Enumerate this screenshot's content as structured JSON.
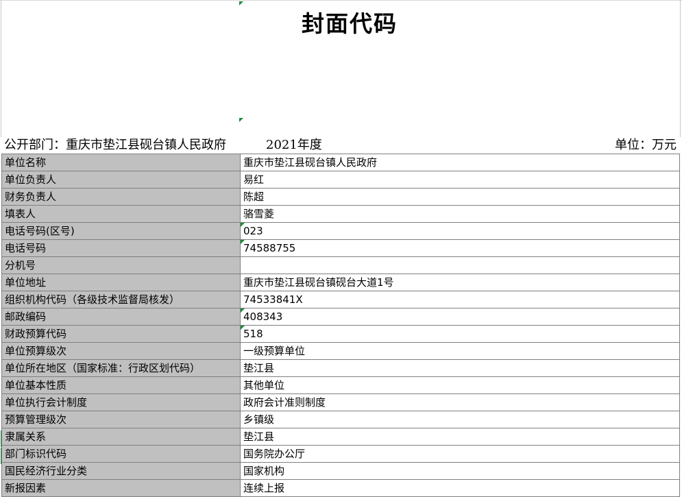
{
  "title": "封面代码",
  "header": {
    "department": "公开部门：重庆市垫江县砚台镇人民政府",
    "year": "2021年度",
    "unit": "单位：万元"
  },
  "rows": [
    {
      "label": "单位名称",
      "value": "重庆市垫江县砚台镇人民政府",
      "flag": false
    },
    {
      "label": "单位负责人",
      "value": "易红",
      "flag": false
    },
    {
      "label": "财务负责人",
      "value": "陈超",
      "flag": false
    },
    {
      "label": "填表人",
      "value": "骆雪菱",
      "flag": false
    },
    {
      "label": "电话号码(区号)",
      "value": "023",
      "flag": true
    },
    {
      "label": "电话号码",
      "value": "74588755",
      "flag": true
    },
    {
      "label": "分机号",
      "value": "",
      "flag": false
    },
    {
      "label": "单位地址",
      "value": "重庆市垫江县砚台镇砚台大道1号",
      "flag": false
    },
    {
      "label": "组织机构代码（各级技术监督局核发）",
      "value": "74533841X",
      "flag": false
    },
    {
      "label": "邮政编码",
      "value": "408343",
      "flag": true
    },
    {
      "label": "财政预算代码",
      "value": "518",
      "flag": true
    },
    {
      "label": "单位预算级次",
      "value": "一级预算单位",
      "flag": false
    },
    {
      "label": "单位所在地区（国家标准：行政区划代码）",
      "value": "垫江县",
      "flag": false
    },
    {
      "label": "单位基本性质",
      "value": "其他单位",
      "flag": false
    },
    {
      "label": "单位执行会计制度",
      "value": "政府会计准则制度",
      "flag": false
    },
    {
      "label": "预算管理级次",
      "value": "乡镇级",
      "flag": false
    },
    {
      "label": "隶属关系",
      "value": "垫江县",
      "flag": false
    },
    {
      "label": "部门标识代码",
      "value": "国务院办公厅",
      "flag": false
    },
    {
      "label": "国民经济行业分类",
      "value": "国家机构",
      "flag": false
    },
    {
      "label": "新报因素",
      "value": "连续上报",
      "flag": false
    }
  ],
  "colors": {
    "label_fill": "#c0c0c0",
    "grid_line": "#7f7f7f",
    "marker": "#1f8a3c"
  }
}
